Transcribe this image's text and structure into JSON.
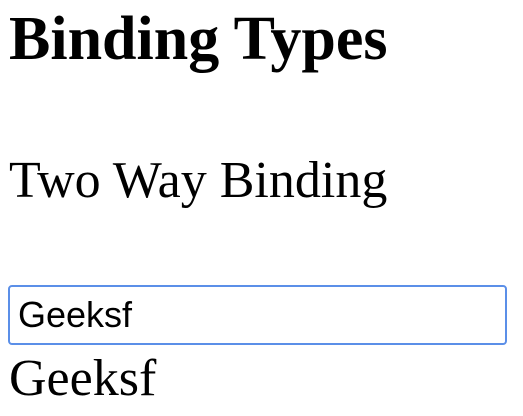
{
  "page": {
    "heading": "Binding Types",
    "subheading": "Two Way Binding"
  },
  "form": {
    "input_value": "Geeksf",
    "focus_color": "#5b8fe8"
  },
  "output": {
    "text": "Geeksf"
  }
}
